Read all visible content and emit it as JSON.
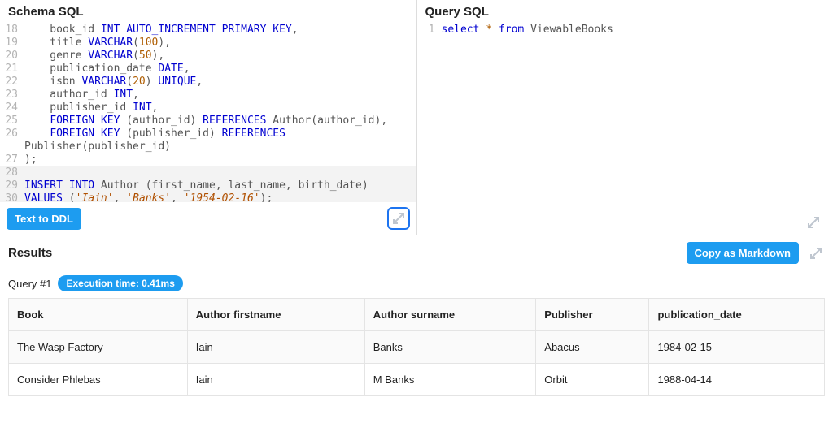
{
  "schema_panel": {
    "title": "Schema SQL",
    "lines": [
      {
        "n": 18,
        "tokens": [
          {
            "t": "    book_id ",
            "c": "pl"
          },
          {
            "t": "INT",
            "c": "kw"
          },
          {
            "t": " ",
            "c": "pl"
          },
          {
            "t": "AUTO_INCREMENT",
            "c": "kw"
          },
          {
            "t": " ",
            "c": "pl"
          },
          {
            "t": "PRIMARY",
            "c": "kw"
          },
          {
            "t": " ",
            "c": "pl"
          },
          {
            "t": "KEY",
            "c": "kw"
          },
          {
            "t": ",",
            "c": "pl"
          }
        ]
      },
      {
        "n": 19,
        "tokens": [
          {
            "t": "    title ",
            "c": "pl"
          },
          {
            "t": "VARCHAR",
            "c": "kw"
          },
          {
            "t": "(",
            "c": "pl"
          },
          {
            "t": "100",
            "c": "num"
          },
          {
            "t": "),",
            "c": "pl"
          }
        ]
      },
      {
        "n": 20,
        "tokens": [
          {
            "t": "    genre ",
            "c": "pl"
          },
          {
            "t": "VARCHAR",
            "c": "kw"
          },
          {
            "t": "(",
            "c": "pl"
          },
          {
            "t": "50",
            "c": "num"
          },
          {
            "t": "),",
            "c": "pl"
          }
        ]
      },
      {
        "n": 21,
        "tokens": [
          {
            "t": "    publication_date ",
            "c": "pl"
          },
          {
            "t": "DATE",
            "c": "kw"
          },
          {
            "t": ",",
            "c": "pl"
          }
        ]
      },
      {
        "n": 22,
        "tokens": [
          {
            "t": "    isbn ",
            "c": "pl"
          },
          {
            "t": "VARCHAR",
            "c": "kw"
          },
          {
            "t": "(",
            "c": "pl"
          },
          {
            "t": "20",
            "c": "num"
          },
          {
            "t": ") ",
            "c": "pl"
          },
          {
            "t": "UNIQUE",
            "c": "kw"
          },
          {
            "t": ",",
            "c": "pl"
          }
        ]
      },
      {
        "n": 23,
        "tokens": [
          {
            "t": "    author_id ",
            "c": "pl"
          },
          {
            "t": "INT",
            "c": "kw"
          },
          {
            "t": ",",
            "c": "pl"
          }
        ]
      },
      {
        "n": 24,
        "tokens": [
          {
            "t": "    publisher_id ",
            "c": "pl"
          },
          {
            "t": "INT",
            "c": "kw"
          },
          {
            "t": ",",
            "c": "pl"
          }
        ]
      },
      {
        "n": 25,
        "tokens": [
          {
            "t": "    ",
            "c": "pl"
          },
          {
            "t": "FOREIGN",
            "c": "kw"
          },
          {
            "t": " ",
            "c": "pl"
          },
          {
            "t": "KEY",
            "c": "kw"
          },
          {
            "t": " (author_id) ",
            "c": "pl"
          },
          {
            "t": "REFERENCES",
            "c": "kw"
          },
          {
            "t": " Author(author_id),",
            "c": "pl"
          }
        ]
      },
      {
        "n": 26,
        "tokens": [
          {
            "t": "    ",
            "c": "pl"
          },
          {
            "t": "FOREIGN",
            "c": "kw"
          },
          {
            "t": " ",
            "c": "pl"
          },
          {
            "t": "KEY",
            "c": "kw"
          },
          {
            "t": " (publisher_id) ",
            "c": "pl"
          },
          {
            "t": "REFERENCES",
            "c": "kw"
          }
        ]
      },
      {
        "n": "",
        "tokens": [
          {
            "t": "Publisher(publisher_id)",
            "c": "pl"
          }
        ]
      },
      {
        "n": 27,
        "tokens": [
          {
            "t": ");",
            "c": "pl"
          }
        ]
      },
      {
        "n": 28,
        "tokens": [
          {
            "t": "",
            "c": "pl"
          }
        ],
        "hl": true
      },
      {
        "n": 29,
        "tokens": [
          {
            "t": "INSERT",
            "c": "kw"
          },
          {
            "t": " ",
            "c": "pl"
          },
          {
            "t": "INTO",
            "c": "kw"
          },
          {
            "t": " Author (first_name, last_name, birth_date)",
            "c": "pl"
          }
        ],
        "hl": true
      },
      {
        "n": 30,
        "tokens": [
          {
            "t": "VALUES",
            "c": "kw"
          },
          {
            "t": " (",
            "c": "pl"
          },
          {
            "t": "'Iain'",
            "c": "str"
          },
          {
            "t": ", ",
            "c": "pl"
          },
          {
            "t": "'Banks'",
            "c": "str"
          },
          {
            "t": ", ",
            "c": "pl"
          },
          {
            "t": "'1954-02-16'",
            "c": "str"
          },
          {
            "t": ");",
            "c": "pl"
          }
        ],
        "hl": true
      }
    ],
    "text_to_ddl_label": "Text to DDL"
  },
  "query_panel": {
    "title": "Query SQL",
    "lines": [
      {
        "n": 1,
        "tokens": [
          {
            "t": "select",
            "c": "kw"
          },
          {
            "t": " ",
            "c": "pl"
          },
          {
            "t": "*",
            "c": "num"
          },
          {
            "t": " ",
            "c": "pl"
          },
          {
            "t": "from",
            "c": "kw"
          },
          {
            "t": " ViewableBooks",
            "c": "pl"
          }
        ]
      }
    ]
  },
  "results": {
    "title": "Results",
    "copy_label": "Copy as Markdown",
    "query_label": "Query #1",
    "exec_pill": "Execution time: 0.41ms",
    "columns": [
      "Book",
      "Author firstname",
      "Author surname",
      "Publisher",
      "publication_date"
    ],
    "rows": [
      [
        "The Wasp Factory",
        "Iain",
        "Banks",
        "Abacus",
        "1984-02-15"
      ],
      [
        "Consider Phlebas",
        "Iain",
        "M Banks",
        "Orbit",
        "1988-04-14"
      ]
    ]
  }
}
